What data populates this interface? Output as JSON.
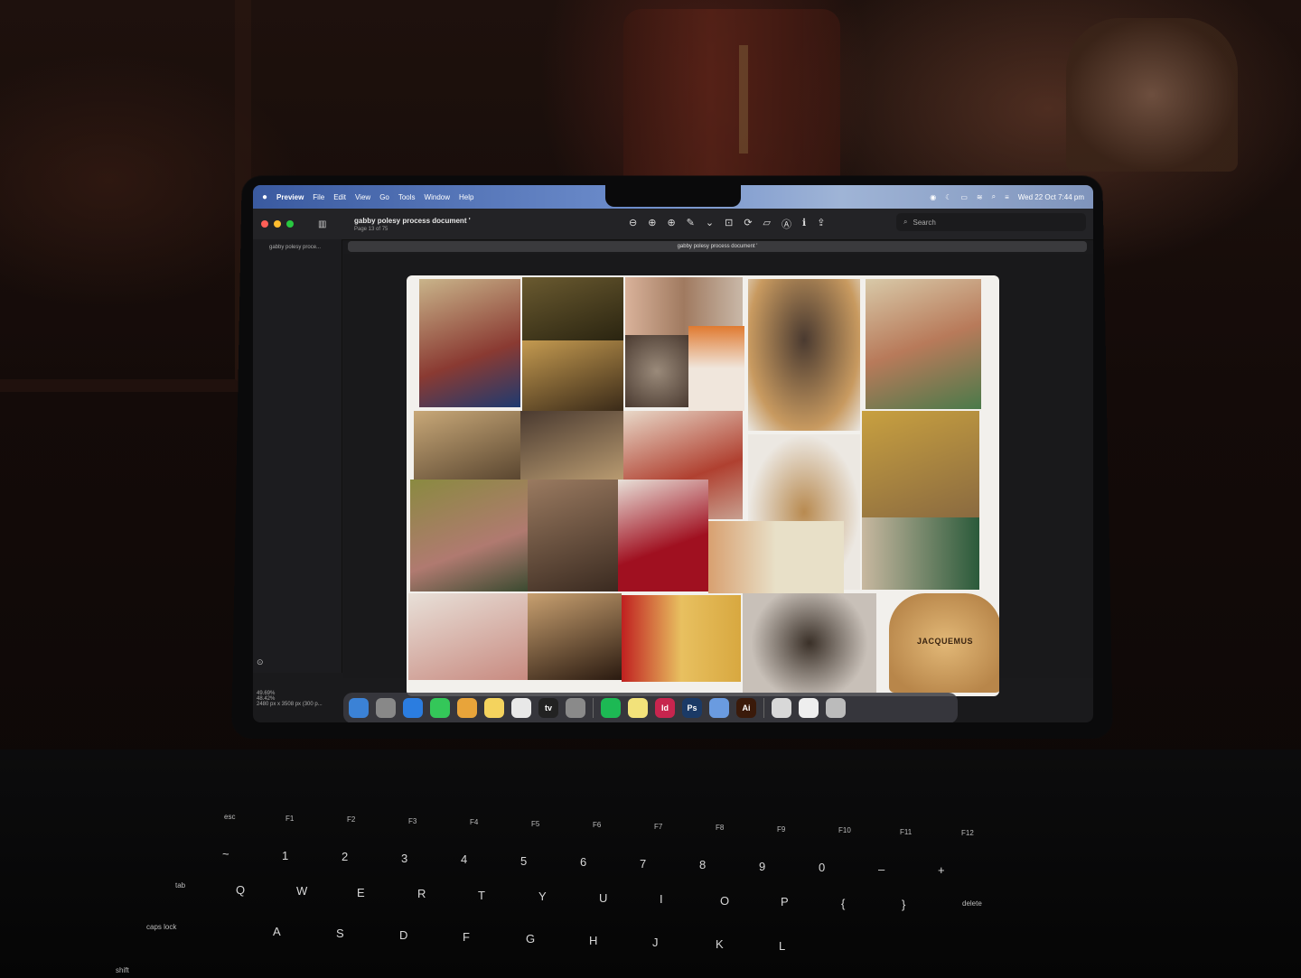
{
  "menubar": {
    "apple": "",
    "items": [
      "Preview",
      "File",
      "Edit",
      "View",
      "Go",
      "Tools",
      "Window",
      "Help"
    ],
    "clock": "Wed 22 Oct  7:44 pm"
  },
  "toolbar": {
    "title": "gabby polesy process document '",
    "page_info": "Page 13 of 75",
    "search_placeholder": "Search"
  },
  "sidebar": {
    "thumb_label": "gabby polesy proce..."
  },
  "tab": {
    "label": "gabby polesy process document '"
  },
  "page": {
    "brand_text": "JACQUEMUS"
  },
  "status": {
    "zoom_a": "49.69%",
    "zoom_b": "48.42%",
    "dims": "2480 px x 3508 px (300 p..."
  },
  "dock": {
    "apps": [
      {
        "label": "",
        "icon": "finder-icon",
        "color": "#3b82d6"
      },
      {
        "label": "",
        "icon": "launchpad-icon",
        "color": "#888"
      },
      {
        "label": "",
        "icon": "safari-icon",
        "color": "#2b7de0"
      },
      {
        "label": "",
        "icon": "messages-icon",
        "color": "#34c759"
      },
      {
        "label": "",
        "icon": "photos-icon",
        "color": "#e8a43a"
      },
      {
        "label": "",
        "icon": "notes-icon",
        "color": "#f4d35e"
      },
      {
        "label": "",
        "icon": "freeform-icon",
        "color": "#e8e8e8"
      },
      {
        "label": "tv",
        "icon": "appletv-icon",
        "color": "#222"
      },
      {
        "label": "",
        "icon": "settings-icon",
        "color": "#8a8a8a"
      },
      {
        "label": "",
        "icon": "spotify-icon",
        "color": "#1db954"
      },
      {
        "label": "",
        "icon": "stickies-icon",
        "color": "#f2e27a"
      },
      {
        "label": "Id",
        "icon": "indesign-icon",
        "color": "#c7254e"
      },
      {
        "label": "Ps",
        "icon": "photoshop-icon",
        "color": "#1b3a66"
      },
      {
        "label": "",
        "icon": "preview-icon",
        "color": "#6a9be0"
      },
      {
        "label": "Ai",
        "icon": "illustrator-icon",
        "color": "#3a1a0a"
      },
      {
        "label": "",
        "icon": "folder-icon",
        "color": "#d8d8d8"
      },
      {
        "label": "",
        "icon": "document-icon",
        "color": "#eee"
      },
      {
        "label": "",
        "icon": "trash-icon",
        "color": "#bbb"
      }
    ]
  },
  "keyboard": {
    "fn_row": [
      "esc",
      "F1",
      "F2",
      "F3",
      "F4",
      "F5",
      "F6",
      "F7",
      "F8",
      "F9",
      "F10",
      "F11",
      "F12"
    ],
    "num_row": [
      "~",
      "1",
      "2",
      "3",
      "4",
      "5",
      "6",
      "7",
      "8",
      "9",
      "0",
      "–",
      "+"
    ],
    "qwerty": [
      "tab",
      "Q",
      "W",
      "E",
      "R",
      "T",
      "Y",
      "U",
      "I",
      "O",
      "P",
      "{",
      "}",
      "delete"
    ],
    "home": [
      "caps lock",
      "A",
      "S",
      "D",
      "F",
      "G",
      "H",
      "J",
      "K",
      "L"
    ],
    "shift": "shift"
  }
}
